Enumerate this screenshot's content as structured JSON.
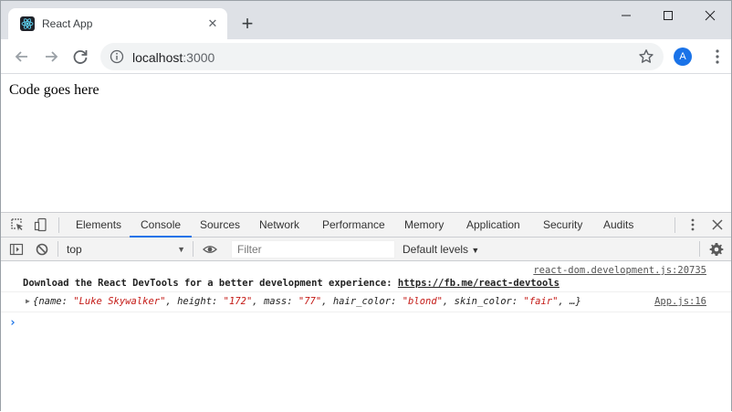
{
  "browser": {
    "tab_title": "React App",
    "url_host": "localhost",
    "url_port": ":3000",
    "avatar_letter": "A",
    "window_controls": {
      "minimize": "—",
      "maximize": "☐",
      "close": "✕"
    },
    "new_tab": "+",
    "tab_close": "✕",
    "accent_color": "#1a73e8"
  },
  "page": {
    "body_text": "Code goes here"
  },
  "devtools": {
    "tabs": [
      "Elements",
      "Console",
      "Sources",
      "Network",
      "Performance",
      "Memory",
      "Application",
      "Security",
      "Audits"
    ],
    "active_tab": "Console",
    "context": "top",
    "filter_placeholder": "Filter",
    "levels_label": "Default levels",
    "messages": [
      {
        "source": "react-dom.development.js:20735",
        "text": "Download the React DevTools for a better development experience: ",
        "link": "https://fb.me/react-devtools"
      },
      {
        "source": "App.js:16",
        "object": {
          "name": "Luke Skywalker",
          "height": "172",
          "mass": "77",
          "hair_color": "blond",
          "skin_color": "fair"
        },
        "ellipsis": "…"
      }
    ],
    "prompt": "›"
  }
}
